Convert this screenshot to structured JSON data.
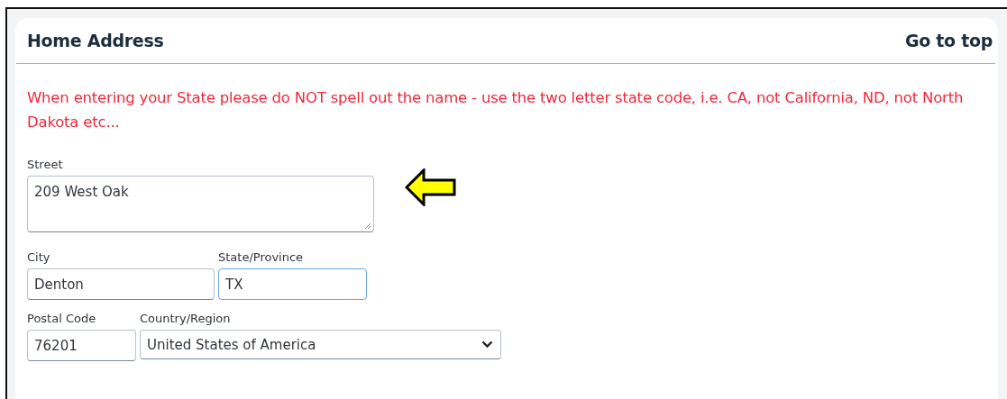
{
  "section": {
    "title": "Home Address",
    "link": "Go to top"
  },
  "notice": "When entering your State please do NOT spell out the name - use the two letter state code, i.e. CA, not California, ND, not North Dakota etc...",
  "rows": [
    [
      {
        "kind": "textarea",
        "label": "Street",
        "value": "209 West Oak",
        "focused": false
      }
    ],
    [
      {
        "kind": "input",
        "label": "City",
        "value": "Denton",
        "focused": false
      },
      {
        "kind": "input",
        "label": "State/Province",
        "value": "TX",
        "focused": true
      }
    ],
    [
      {
        "kind": "input",
        "label": "Postal Code",
        "value": "76201",
        "focused": false
      },
      {
        "kind": "select",
        "label": "Country/Region",
        "value": "United States of America",
        "focused": false
      }
    ]
  ]
}
